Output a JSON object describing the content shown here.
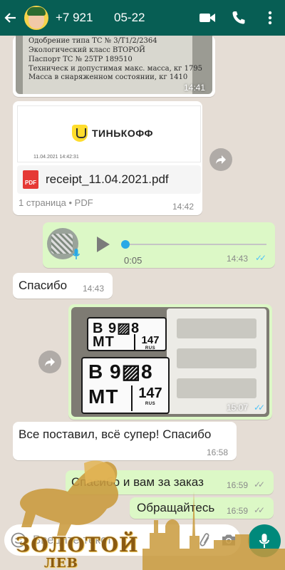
{
  "header": {
    "contact_name": "+7 921",
    "date_label": "05-22",
    "icons": [
      "back-arrow-icon",
      "video-call-icon",
      "phone-icon",
      "more-vertical-icon"
    ],
    "bg_color": "#075e54"
  },
  "messages": {
    "doc_photo": {
      "lines": [
        "Одобрение типа ТС № 3/Т1/2/2364",
        "Экологический класс    ВТОРОЙ",
        "Паспорт ТС №   25ТР  189510",
        "Техническ и допустимая макс. масса, кг 1795",
        "Масса в снаряженном состоянии, кг    1410"
      ],
      "time": "14:41"
    },
    "pdf": {
      "brand": "ТИНЬКОФФ",
      "preview_date": "11.04.2021   14:42:31",
      "badge": "PDF",
      "filename": "receipt_11.04.2021.pdf",
      "meta": "1 страница • PDF",
      "time": "14:42"
    },
    "voice": {
      "duration": "0:05",
      "time": "14:43"
    },
    "thanks": {
      "text": "Спасибо",
      "time": "14:43"
    },
    "plates_photo": {
      "plate_main": "В 9▨8",
      "plate_series": "МТ",
      "plate_region": "147",
      "plate_country": "RUS",
      "time": "15:07"
    },
    "review": {
      "text": "Все поставил, всё супер! Спасибо",
      "time": "16:58"
    },
    "reply1": {
      "text": "Спасибо и вам за заказ",
      "time": "16:59"
    },
    "reply2": {
      "text": "Обращайтесь",
      "time": "16:59"
    }
  },
  "input": {
    "placeholder": "Введите текст"
  },
  "watermark": {
    "line1": "ЗОЛОТОЙ",
    "line2": "ЛЕВ"
  },
  "colors": {
    "outgoing": "#dcf8c6",
    "incoming": "#ffffff",
    "read_ticks": "#4fc3f7",
    "accent": "#00897b"
  }
}
